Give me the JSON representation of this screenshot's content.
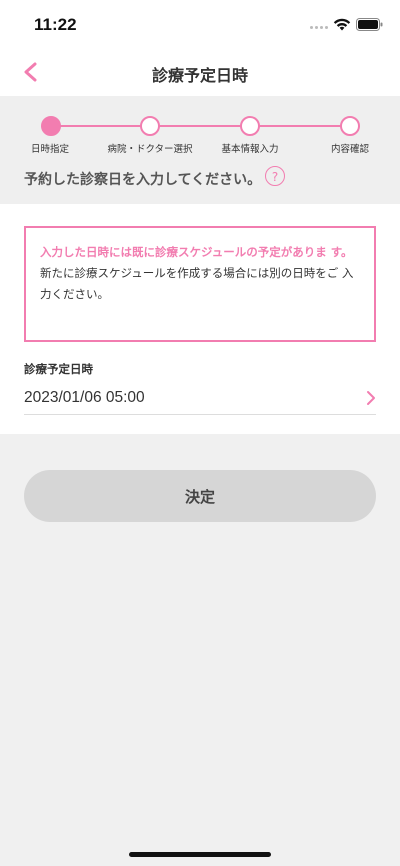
{
  "status_bar": {
    "time": "11:22"
  },
  "header": {
    "title": "診療予定日時",
    "back_icon": "chevron-left-icon",
    "accent": "#f27db0"
  },
  "stepper": {
    "steps": [
      {
        "label": "日時指定",
        "active": true
      },
      {
        "label": "病院・ドクター選択",
        "active": false
      },
      {
        "label": "基本情報入力",
        "active": false
      },
      {
        "label": "内容確認",
        "active": false
      }
    ],
    "instruction": "予約した診察日を入力してください。",
    "help_label": "?"
  },
  "alert": {
    "title": "入力した日時には既に診療スケジュールの予定がありま す。",
    "body": "新たに診療スケジュールを作成する場合には別の日時をご 入力ください。"
  },
  "form": {
    "field_label": "診療予定日時",
    "field_value": "2023/01/06 05:00"
  },
  "actions": {
    "submit_label": "決定"
  }
}
